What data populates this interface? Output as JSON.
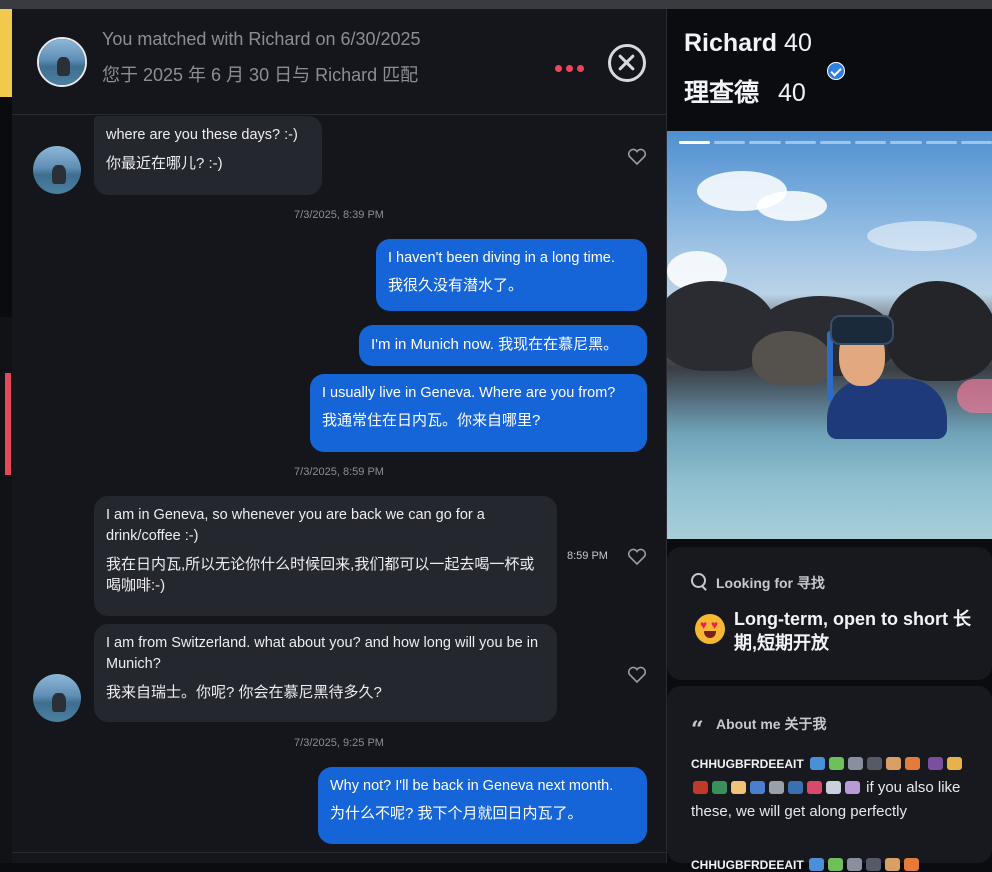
{
  "chat": {
    "header": {
      "match_en": "You matched with Richard on 6/30/2025",
      "match_zh": "您于 2025 年 6 月 30 日与 Richard 匹配"
    },
    "messages": [
      {
        "en": "where are you these days? :-)",
        "zh": "你最近在哪儿? :-)"
      },
      {
        "en": "I haven't been diving in a long time.",
        "zh": "我很久没有潜水了。"
      },
      {
        "en": "I'm in Munich now.  我现在在慕尼黑。"
      },
      {
        "en": "I usually live in Geneva. Where are you from?",
        "zh": "我通常住在日内瓦。你来自哪里?"
      },
      {
        "en": "I am in Geneva, so whenever you are back we can go for a drink/coffee :-)",
        "zh": "我在日内瓦,所以无论你什么时候回来,我们都可以一起去喝一杯或喝咖啡:-)"
      },
      {
        "en": "I am from Switzerland. what about you? and how long will you be in Munich?",
        "zh": "我来自瑞士。你呢? 你会在慕尼黑待多久?"
      },
      {
        "en": "Why not? I'll be back in Geneva next month.",
        "zh": "为什么不呢? 我下个月就回日内瓦了。"
      }
    ],
    "timestamps": [
      "7/3/2025, 8:39 PM",
      "7/3/2025, 8:59 PM",
      "7/3/2025, 9:25 PM"
    ],
    "side_time": "8:59 PM"
  },
  "profile": {
    "name": "Richard",
    "age": "40",
    "name_zh": "理查德",
    "age_zh": "40",
    "looking_for_label": "Looking for  寻找",
    "looking_for_value": "Long-term, open to short  长期,短期开放",
    "about_label": "About me  关于我",
    "about_code": "CHHUGBFRDEEAIT",
    "about_text": "if you also like these, we will get along perfectly",
    "about_code2": "CHHUGBFRDEEAIT"
  },
  "colors": {
    "accent_red": "#f0455c",
    "bubble_out": "#1565d8",
    "bubble_in": "#25272e"
  }
}
